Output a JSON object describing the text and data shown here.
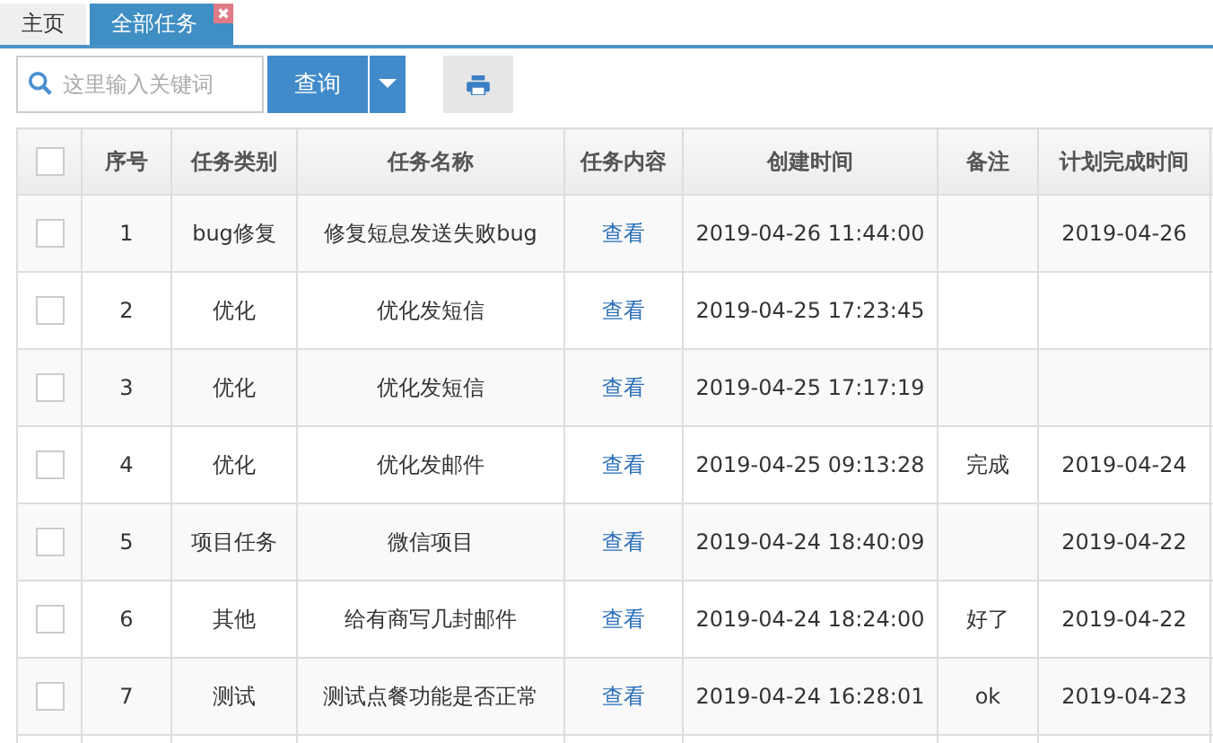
{
  "tabs": [
    {
      "label": "主页",
      "selected": false,
      "closable": false
    },
    {
      "label": "全部任务",
      "selected": true,
      "closable": true
    }
  ],
  "search": {
    "placeholder": "这里输入关键词"
  },
  "query_button": "查询",
  "table": {
    "header_checked": false,
    "columns": [
      "序号",
      "任务类别",
      "任务名称",
      "任务内容",
      "创建时间",
      "备注",
      "计划完成时间"
    ],
    "rows": [
      {
        "checked": false,
        "cells": [
          "1",
          "bug修复",
          "修复短息发送失败bug",
          "查看",
          "2019-04-26 11:44:00",
          "",
          "2019-04-26"
        ]
      },
      {
        "checked": false,
        "cells": [
          "2",
          "优化",
          "优化发短信",
          "查看",
          "2019-04-25 17:23:45",
          "",
          ""
        ]
      },
      {
        "checked": false,
        "cells": [
          "3",
          "优化",
          "优化发短信",
          "查看",
          "2019-04-25 17:17:19",
          "",
          ""
        ]
      },
      {
        "checked": false,
        "cells": [
          "4",
          "优化",
          "优化发邮件",
          "查看",
          "2019-04-25 09:13:28",
          "完成",
          "2019-04-24"
        ]
      },
      {
        "checked": false,
        "cells": [
          "5",
          "项目任务",
          "微信项目",
          "查看",
          "2019-04-24 18:40:09",
          "",
          "2019-04-22"
        ]
      },
      {
        "checked": false,
        "cells": [
          "6",
          "其他",
          "给有商写几封邮件",
          "查看",
          "2019-04-24 18:24:00",
          "好了",
          "2019-04-22"
        ]
      },
      {
        "checked": false,
        "cells": [
          "7",
          "测试",
          "测试点餐功能是否正常",
          "查看",
          "2019-04-24 16:28:01",
          "ok",
          "2019-04-23"
        ]
      }
    ]
  }
}
